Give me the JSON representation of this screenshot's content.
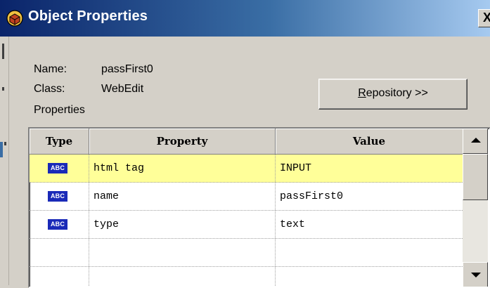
{
  "window": {
    "title": "Object Properties",
    "close_glyph": "X"
  },
  "object": {
    "name_label": "Name:",
    "name_value": "passFirst0",
    "class_label": "Class:",
    "class_value": "WebEdit",
    "properties_label": "Properties"
  },
  "repository_button": {
    "label_accel": "R",
    "label_rest": "epository >>"
  },
  "grid": {
    "headers": {
      "type": "Type",
      "property": "Property",
      "value": "Value"
    },
    "rows": [
      {
        "type_icon": "ABC",
        "property": "html tag",
        "value": "INPUT",
        "selected": true
      },
      {
        "type_icon": "ABC",
        "property": "name",
        "value": "passFirst0",
        "selected": false
      },
      {
        "type_icon": "ABC",
        "property": "type",
        "value": "text",
        "selected": false
      },
      {
        "type_icon": "",
        "property": "",
        "value": "",
        "selected": false
      },
      {
        "type_icon": "",
        "property": "",
        "value": "",
        "selected": false
      }
    ]
  },
  "colors": {
    "title_bar": "#0a246a",
    "selected_row": "#ffff99",
    "abc_badge": "#1a2ab8"
  },
  "icons": {
    "app": "object-properties-icon",
    "type": "abc-string-icon"
  }
}
